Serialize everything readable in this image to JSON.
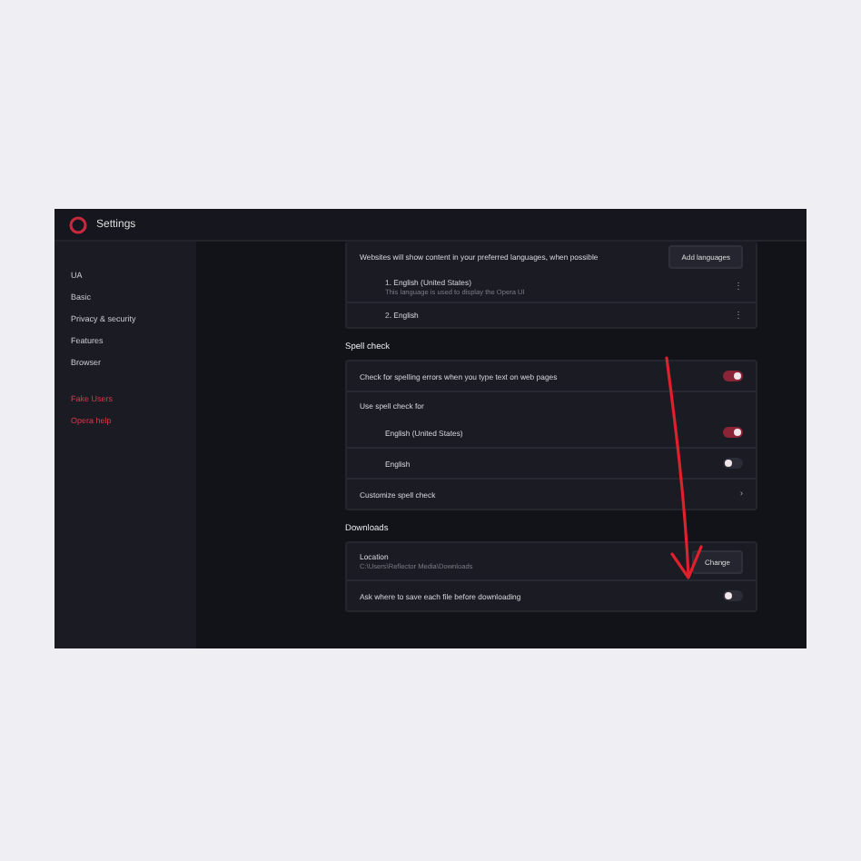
{
  "window": {
    "title": "Settings"
  },
  "sidebar": {
    "items": [
      {
        "label": "UA",
        "kind": "nav"
      },
      {
        "label": "Basic",
        "kind": "nav"
      },
      {
        "label": "Privacy & security",
        "kind": "nav"
      },
      {
        "label": "Features",
        "kind": "nav"
      },
      {
        "label": "Browser",
        "kind": "nav"
      },
      {
        "label": "Fake Users",
        "kind": "link"
      },
      {
        "label": "Opera help",
        "kind": "link"
      }
    ]
  },
  "languages": {
    "intro": "Websites will show content in your preferred languages, when possible",
    "add_button": "Add languages",
    "items": [
      {
        "name": "1. English (United States)",
        "note": "This language is used to display the Opera UI",
        "menu": "⋮"
      },
      {
        "name": "2. English",
        "menu": "⋮"
      }
    ]
  },
  "spell_check": {
    "heading": "Spell check",
    "rows": [
      {
        "kind": "toggle",
        "label": "Check for spelling errors when you type text on web pages",
        "on": true
      },
      {
        "kind": "label",
        "label": "Use spell check for"
      },
      {
        "kind": "toggle",
        "label": "English (United States)",
        "on": true,
        "indent": true
      },
      {
        "kind": "toggle",
        "label": "English",
        "on": false,
        "indent": true
      },
      {
        "kind": "link",
        "label": "Customize spell check",
        "chevron": "›"
      }
    ]
  },
  "downloads": {
    "heading": "Downloads",
    "location_label": "Location",
    "location_path": "C:\\Users\\Reflector Media\\Downloads",
    "change_button": "Change",
    "ask_label": "Ask where to save each file before downloading",
    "ask_on": false
  }
}
